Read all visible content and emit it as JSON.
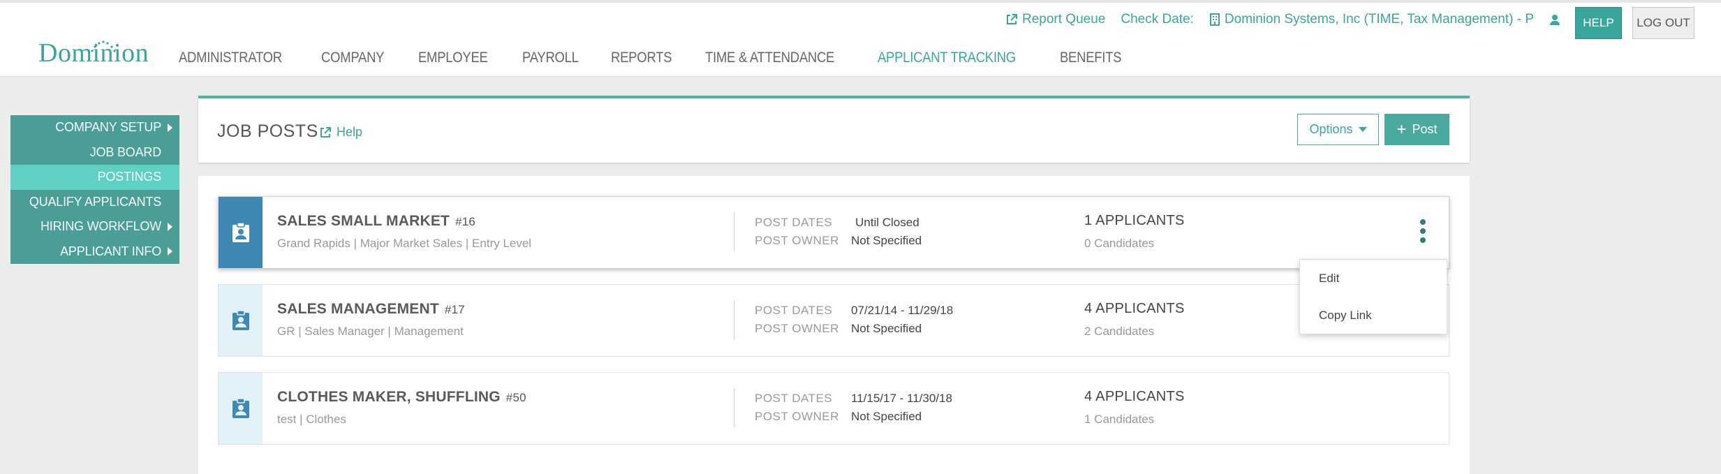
{
  "header": {
    "logo": "Dominion",
    "report_queue": "Report Queue",
    "check_date": "Check Date:",
    "company": "Dominion Systems, Inc (TIME, Tax Management) - P",
    "help": "HELP",
    "logout": "LOG OUT"
  },
  "nav": [
    "ADMINISTRATOR",
    "COMPANY",
    "EMPLOYEE",
    "PAYROLL",
    "REPORTS",
    "TIME & ATTENDANCE",
    "APPLICANT TRACKING",
    "BENEFITS"
  ],
  "nav_active": "APPLICANT TRACKING",
  "sidebar": {
    "items": [
      {
        "label": "COMPANY SETUP",
        "caret": true
      },
      {
        "label": "JOB BOARD",
        "caret": false
      },
      {
        "label": "POSTINGS",
        "caret": false,
        "active": true
      },
      {
        "label": "QUALIFY APPLICANTS",
        "caret": false
      },
      {
        "label": "HIRING WORKFLOW",
        "caret": true
      },
      {
        "label": "APPLICANT INFO",
        "caret": true
      }
    ]
  },
  "panel": {
    "title": "JOB POSTS",
    "help": "Help",
    "options": "Options",
    "post": "Post"
  },
  "labels": {
    "post_dates": "POST DATES",
    "post_owner": "POST OWNER"
  },
  "jobs": [
    {
      "title": "SALES SMALL MARKET",
      "num": "#16",
      "meta": "Grand Rapids  |  Major Market Sales  |  Entry Level",
      "dates": "Until Closed",
      "owner": "Not Specified",
      "applicants": "1 APPLICANTS",
      "candidates": "0 Candidates"
    },
    {
      "title": "SALES MANAGEMENT",
      "num": "#17",
      "meta": "GR  |  Sales Manager  |  Management",
      "dates": "07/21/14  -  11/29/18",
      "owner": "Not Specified",
      "applicants": "4 APPLICANTS",
      "candidates": "2 Candidates"
    },
    {
      "title": "CLOTHES MAKER, SHUFFLING",
      "num": "#50",
      "meta": "test  |  Clothes",
      "dates": "11/15/17  -  11/30/18",
      "owner": "Not Specified",
      "applicants": "4 APPLICANTS",
      "candidates": "1 Candidates"
    }
  ],
  "menu": {
    "items": [
      "Edit",
      "Copy Link"
    ]
  },
  "colors": {
    "accent": "#3aa59b",
    "sidebar": "#4a9e96",
    "sidebar_active": "#5fd0c4",
    "selected_icon_bg": "#3d88b5",
    "icon_bg": "#e3f1f8"
  }
}
